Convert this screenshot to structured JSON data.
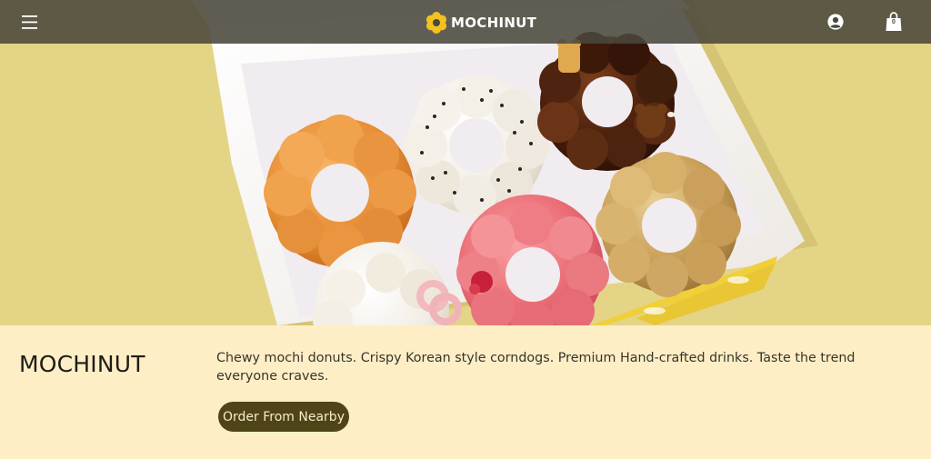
{
  "header": {
    "brand_name": "MOCHINUT",
    "cart_count": "0"
  },
  "icons": {
    "menu": "hamburger-menu-icon",
    "logo": "flower-donut-logo-icon",
    "account": "user-circle-icon",
    "cart": "shopping-bag-icon"
  },
  "hero": {
    "image": "box of six mochi donuts: orange sugar, sesame glaze, chocolate bear, pink strawberry, cinnamon sugar, white chocolate pretzel"
  },
  "info": {
    "title": "MOCHINUT",
    "description": "Chewy mochi donuts. Crispy Korean style corndogs. Premium Hand-crafted drinks. Taste the trend everyone craves.",
    "cta_label": "Order From Nearby"
  },
  "colors": {
    "hero_background": "#e4d486",
    "header_background": "#4a483c",
    "info_background": "#fdeec5",
    "cta_background": "#4f4418",
    "logo_yellow": "#f3c21f"
  }
}
